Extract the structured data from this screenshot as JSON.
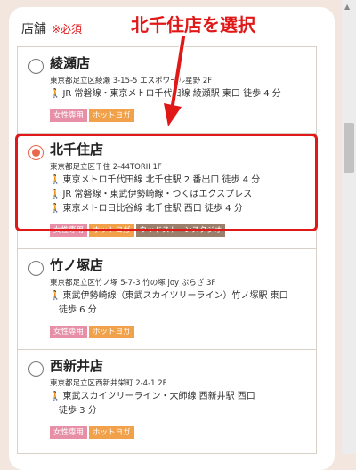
{
  "header": {
    "title": "店舗",
    "required": "※必須"
  },
  "annotation": {
    "text": "北千住店を選択",
    "color": "#e01818"
  },
  "stores": [
    {
      "name": "綾瀬店",
      "selected": false,
      "address": "東京都足立区綾瀬 3-15-5 エスポワール星野 2F",
      "access": [
        "JR 常磐線・東京メトロ千代田線 綾瀬駅 東口 徒歩 4 分"
      ],
      "tags": [
        "女性専用",
        "ホットヨガ"
      ]
    },
    {
      "name": "北千住店",
      "selected": true,
      "address": "東京都足立区千住 2-44TORII 1F",
      "access": [
        "東京メトロ千代田線 北千住駅 2 番出口 徒歩 4 分",
        "JR 常磐線・東武伊勢崎線・つくばエクスプレス",
        "東京メトロ日比谷線 北千住駅 西口 徒歩 4 分"
      ],
      "tags": [
        "女性専用",
        "ホットヨガ",
        "ウッドストーンスタジオ"
      ]
    },
    {
      "name": "竹ノ塚店",
      "selected": false,
      "address": "東京都足立区竹ノ塚 5-7-3 竹の塚 joy ぷらざ 3F",
      "access": [
        "東武伊勢崎線（東武スカイツリーライン）竹ノ塚駅 東口",
        "徒歩 6 分"
      ],
      "tags": [
        "女性専用",
        "ホットヨガ"
      ]
    },
    {
      "name": "西新井店",
      "selected": false,
      "address": "東京都足立区西新井栄町 2-4-1 2F",
      "access": [
        "東武スカイツリーライン・大師線 西新井駅 西口",
        "徒歩 3 分"
      ],
      "tags": [
        "女性専用",
        "ホットヨガ"
      ]
    }
  ],
  "icons": {
    "walk": "walking-person-icon",
    "scroll_up": "triangle-up-icon"
  },
  "colors": {
    "accent": "#e8674d",
    "women_tag": "#e68fa6",
    "hot_tag": "#f0a14a",
    "wood_tag": "#9a7f6c"
  }
}
